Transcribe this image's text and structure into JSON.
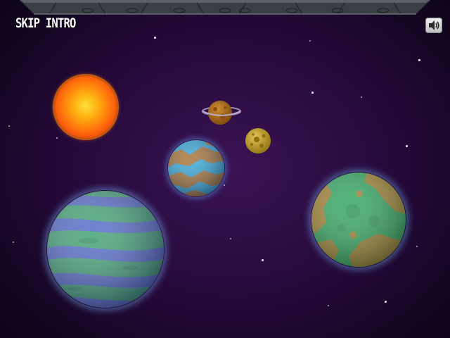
{
  "intro": {
    "skip_label": "SKIP INTRO"
  },
  "icons": {
    "sound": "speaker-icon"
  },
  "colors": {
    "space_background": "#25093a",
    "sun": "#ff8a12",
    "ocean": "#3aa8d8",
    "land_brown": "#a8753a",
    "green_planet": "#3aa866",
    "gas_giant_blue": "#5b6fc9",
    "gas_giant_green": "#48a678",
    "moon_yellow": "#d6b42e"
  }
}
